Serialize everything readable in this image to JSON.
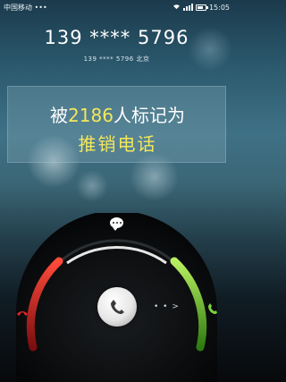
{
  "status_bar": {
    "carrier": "中国移动 •••",
    "time": "15:05"
  },
  "caller": {
    "number": "139 **** 5796",
    "number_small": "139 **** 5796",
    "location": "北京"
  },
  "banner": {
    "prefix": "被",
    "count": "2186",
    "suffix": "人标记为",
    "tag": "推销电话"
  },
  "slider": {
    "hint": "• • >"
  },
  "icons": {
    "message": "message-bubble-icon",
    "decline": "hang-up-phone-icon",
    "answer": "answer-phone-icon",
    "handle": "phone-handle-icon"
  },
  "colors": {
    "decline": "#e0252a",
    "answer": "#7fd33a",
    "tag_text": "#f4e75a"
  }
}
